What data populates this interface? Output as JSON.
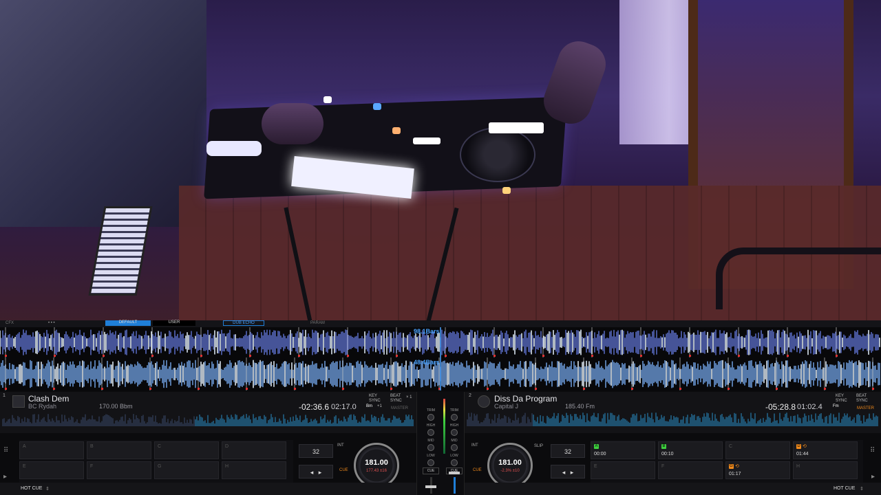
{
  "topbar": {
    "cfx_label": "CFX",
    "default_label": "DEFAULT",
    "user_label": "USER",
    "fx_select": "DUB ECHO",
    "param_label": "PARAM"
  },
  "overview": {
    "deck1_bars": "98.1Bars",
    "deck2_bars": "48.4Bars"
  },
  "deck1": {
    "number": "1",
    "title": "Clash Dem",
    "artist": "BC Rydah",
    "bpm_key": "170.00 Bbm",
    "time_remaining": "-02:36.6",
    "time_elapsed": "02:17.0",
    "key_sync_label": "KEY SYNC",
    "key_value": "Bm",
    "key_shift": "+1",
    "beat_sync_label": "BEAT SYNC",
    "master_label": "MASTER",
    "x1": "× 1",
    "loop_value": "32",
    "int_label": "INT",
    "cue_label": "CUE",
    "platter_bpm": "181.00",
    "platter_sub": "177.43  ±16",
    "hotcue_label": "HOT CUE",
    "pads": [
      {
        "letter": "A",
        "time": ""
      },
      {
        "letter": "B",
        "time": ""
      },
      {
        "letter": "C",
        "time": ""
      },
      {
        "letter": "D",
        "time": ""
      },
      {
        "letter": "E",
        "time": ""
      },
      {
        "letter": "F",
        "time": ""
      },
      {
        "letter": "G",
        "time": ""
      },
      {
        "letter": "H",
        "time": ""
      }
    ]
  },
  "deck2": {
    "number": "2",
    "title": "Diss Da Program",
    "artist": "Capital J",
    "bpm_key": "185.40 Fm",
    "time_remaining": "-05:28.8",
    "time_elapsed": "01:02.4",
    "key_sync_label": "KEY SYNC",
    "key_value": "Fm",
    "beat_sync_label": "BEAT SYNC",
    "master_label": "MASTER",
    "loop_value": "32",
    "int_label": "INT",
    "slip_label": "SLIP",
    "cue_label": "CUE",
    "platter_bpm": "181.00",
    "platter_sub": "-2.3%  ±10",
    "hotcue_label": "HOT CUE",
    "pads": [
      {
        "letter": "A",
        "time": "00:00",
        "color": "#3ecf3e"
      },
      {
        "letter": "B",
        "time": "00:10",
        "color": "#3ecf3e"
      },
      {
        "letter": "C",
        "time": ""
      },
      {
        "letter": "D",
        "time": "01:44",
        "color": "#f08a1c"
      },
      {
        "letter": "E",
        "time": ""
      },
      {
        "letter": "F",
        "time": ""
      },
      {
        "letter": "G",
        "time": "01:17",
        "color": "#f08a1c"
      },
      {
        "letter": "H",
        "time": ""
      }
    ]
  },
  "mixer": {
    "trim_label": "TRIM",
    "high_label": "HIGH",
    "mid_label": "MID",
    "low_label": "LOW",
    "cue_label": "CUE"
  },
  "colors": {
    "accent_blue": "#4aa3ff",
    "cue_green": "#3ecf3e",
    "cue_orange": "#f08a1c",
    "wave_cyan": "#a8e8ff"
  }
}
